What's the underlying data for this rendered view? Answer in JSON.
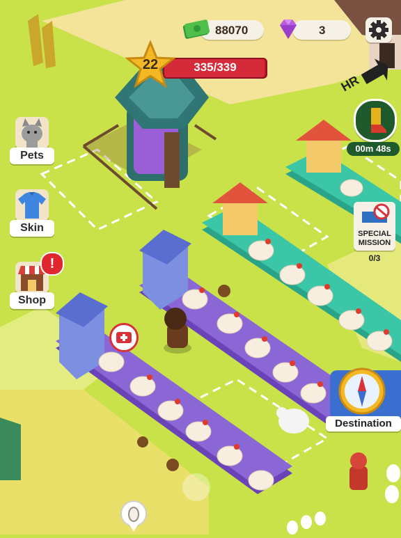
{
  "hud": {
    "cash_value": "88070",
    "gems_value": "3",
    "level_number": "22",
    "xp_text": "335/339",
    "xp_progress": 0.988,
    "settings_icon": "gear-icon"
  },
  "side_menu": {
    "pets_label": "Pets",
    "skin_label": "Skin",
    "shop_label": "Shop",
    "shop_alert": "!"
  },
  "right_panel": {
    "hr_label": "HR",
    "timer_text": "00m 48s",
    "special_mission_line1": "SPECIAL",
    "special_mission_line2": "MISSION",
    "mission_progress": "0/3",
    "destination_label": "Destination"
  },
  "colors": {
    "grass": "#c9e24a",
    "path": "#f2d98a",
    "coop_purple": "#8b67d6",
    "coop_teal": "#3cc6a8",
    "accent_red": "#c0162b",
    "gem_purple": "#b85be0",
    "cash_green": "#4fbf4a"
  }
}
